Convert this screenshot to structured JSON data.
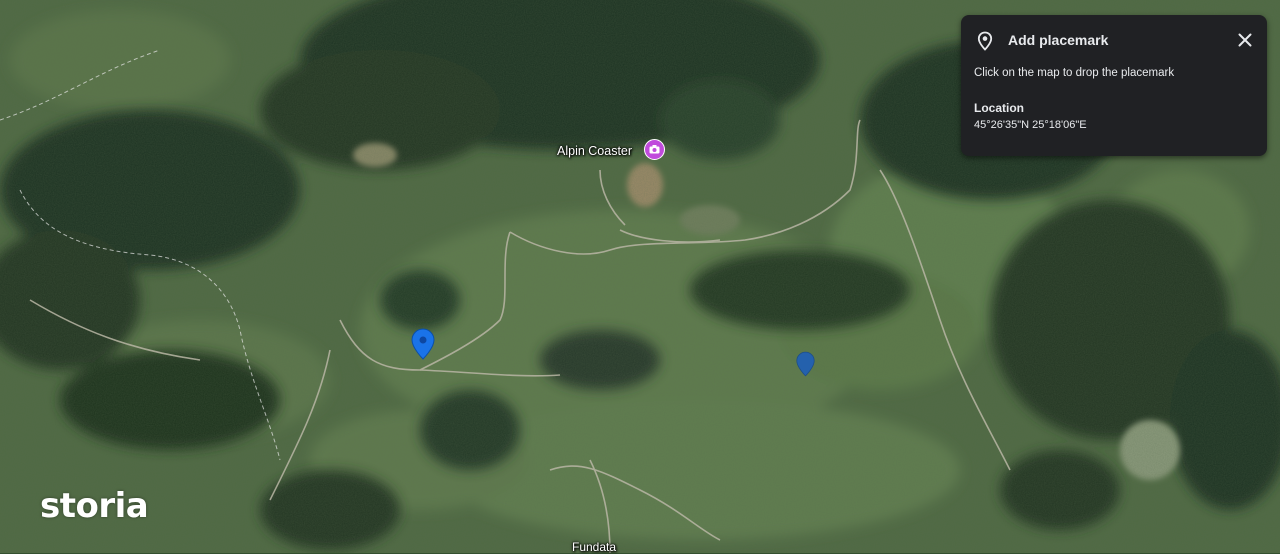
{
  "panel": {
    "title": "Add placemark",
    "instruction": "Click on the map to drop the placemark",
    "location_label": "Location",
    "location_value": "45°26'35\"N 25°18'06\"E",
    "pin_icon": "location-pin-icon",
    "close_icon": "close-icon"
  },
  "map": {
    "poi_label": "Alpin Coaster",
    "poi_icon": "camera-icon",
    "poi_color": "#c04bdc",
    "town_label": "Fundata",
    "pin_color": "#1a73e8",
    "placemarks": 2
  },
  "watermark": {
    "brand": "storia"
  }
}
